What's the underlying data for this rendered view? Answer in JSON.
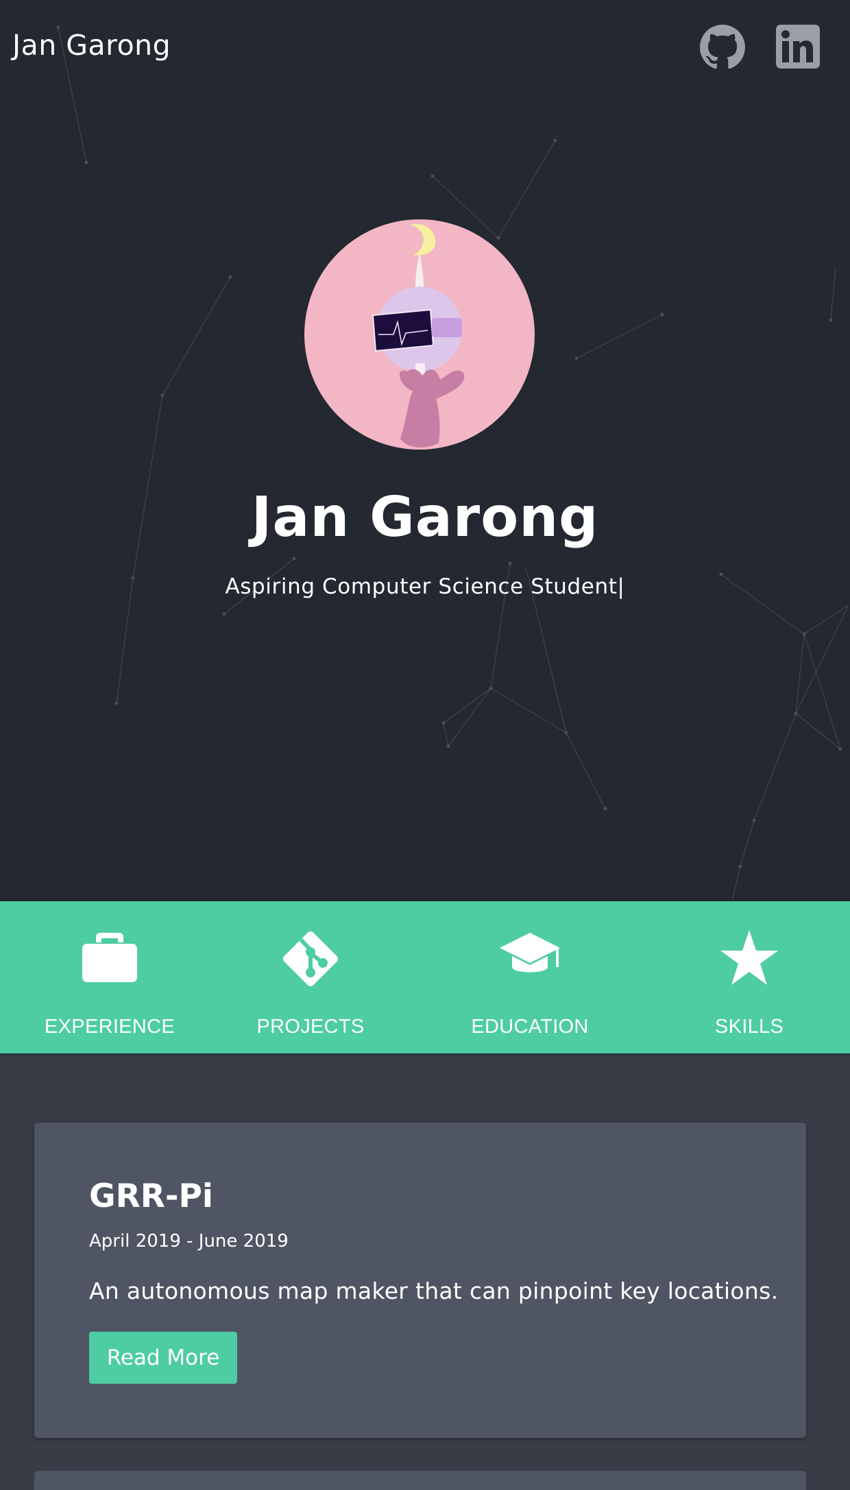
{
  "header": {
    "brand": "Jan Garong",
    "social": [
      {
        "icon": "github-icon"
      },
      {
        "icon": "linkedin-icon"
      }
    ]
  },
  "hero": {
    "title": "Jan Garong",
    "subtitle": "Aspiring Computer Science Student|"
  },
  "nav": {
    "items": [
      {
        "label": "EXPERIENCE",
        "icon": "briefcase-icon"
      },
      {
        "label": "PROJECTS",
        "icon": "git-icon"
      },
      {
        "label": "EDUCATION",
        "icon": "graduation-cap-icon"
      },
      {
        "label": "SKILLS",
        "icon": "star-icon"
      }
    ]
  },
  "projects": [
    {
      "title": "GRR-Pi",
      "date": "April 2019 - June 2019",
      "description": "An autonomous map maker that can pinpoint key locations.",
      "button_label": "Read More"
    }
  ],
  "colors": {
    "hero_bg": "#232831",
    "accent": "#4ecca3",
    "page_bg": "#383c46",
    "card_bg": "#4f5562",
    "avatar_bg": "#f2b6c4"
  }
}
